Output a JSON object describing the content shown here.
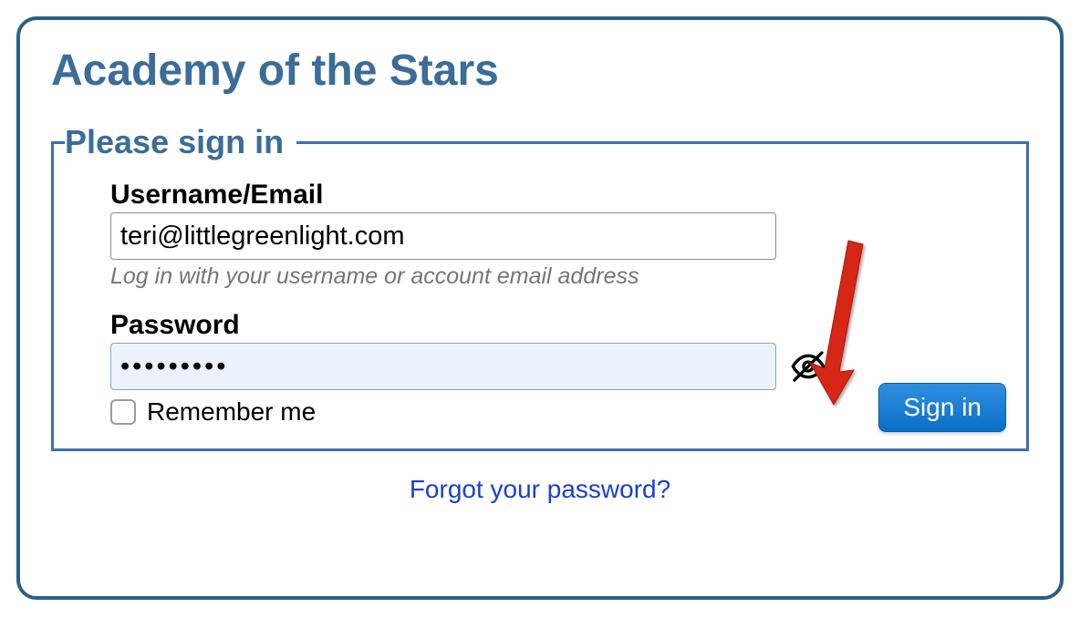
{
  "appTitle": "Academy of the Stars",
  "signin": {
    "legend": "Please sign in",
    "usernameLabel": "Username/Email",
    "usernameValue": "teri@littlegreenlight.com",
    "usernameHelp": "Log in with your username or account email address",
    "passwordLabel": "Password",
    "passwordValue": "•••••••••",
    "rememberLabel": "Remember me",
    "submitLabel": "Sign in"
  },
  "forgotLink": "Forgot your password?"
}
